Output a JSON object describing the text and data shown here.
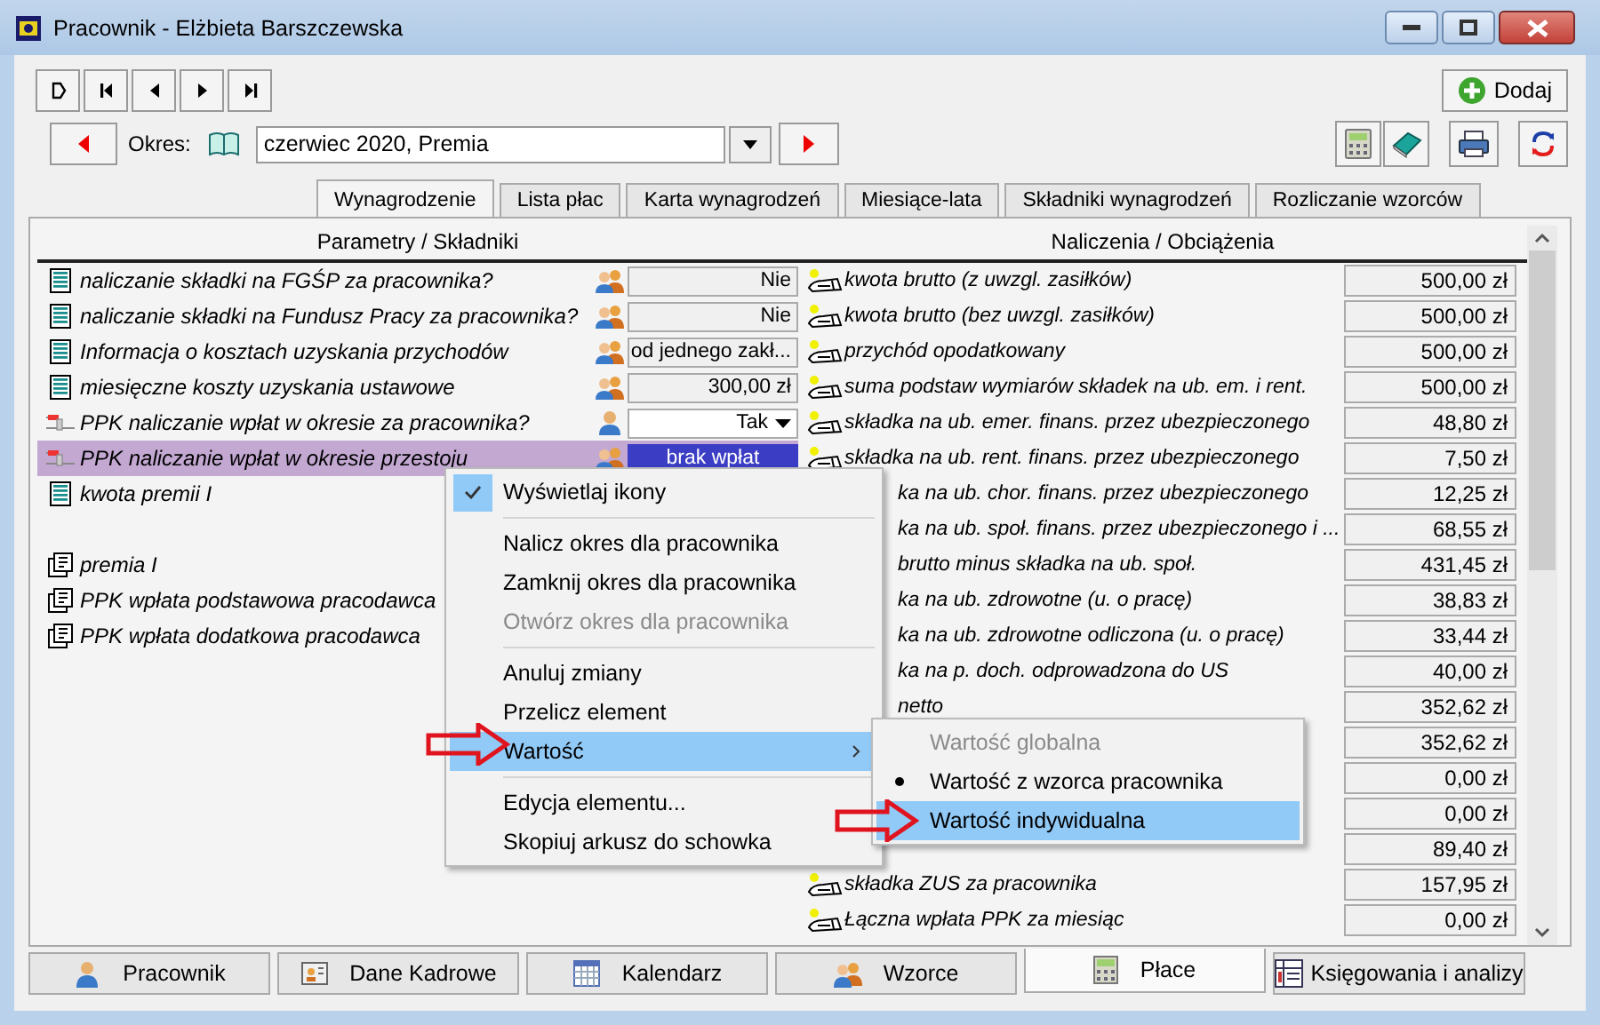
{
  "window": {
    "title": "Pracownik - Elżbieta Barszczewska"
  },
  "nav_buttons": [
    {
      "kind": "new"
    },
    {
      "kind": "first"
    },
    {
      "kind": "prev"
    },
    {
      "kind": "next"
    },
    {
      "kind": "last"
    }
  ],
  "add_button": {
    "label": "Dodaj"
  },
  "period": {
    "label": "Okres:",
    "value": "czerwiec 2020, Premia"
  },
  "tabs": [
    {
      "label": "Wynagrodzenie",
      "selected": true
    },
    {
      "label": "Lista płac",
      "selected": false
    },
    {
      "label": "Karta wynagrodzeń",
      "selected": false
    },
    {
      "label": "Miesiące-lata",
      "selected": false
    },
    {
      "label": "Składniki wynagrodzeń",
      "selected": false
    },
    {
      "label": "Rozliczanie wzorców",
      "selected": false
    }
  ],
  "left_panel": {
    "header": "Parametry / Składniki",
    "rows": [
      {
        "kind": "sheet",
        "name": "naliczanie składki na FGŚP za pracownika?",
        "individual": false,
        "value": "Nie",
        "has_dropdown": false,
        "selected": false
      },
      {
        "kind": "sheet",
        "name": "naliczanie składki na Fundusz Pracy za pracownika?",
        "individual": false,
        "value": "Nie",
        "has_dropdown": false,
        "selected": false
      },
      {
        "kind": "sheet",
        "name": "Informacja o kosztach uzyskania przychodów",
        "individual": false,
        "value": "od jednego zakł...",
        "has_dropdown": false,
        "selected": false
      },
      {
        "kind": "sheet",
        "name": "miesięczne koszty uzyskania ustawowe",
        "individual": false,
        "value": "300,00 zł",
        "has_dropdown": false,
        "selected": false
      },
      {
        "kind": "ppk",
        "name": "PPK naliczanie wpłat w okresie za pracownika?",
        "individual": true,
        "value": "Tak",
        "has_dropdown": true,
        "selected": false
      },
      {
        "kind": "ppk",
        "name": "PPK naliczanie wpłat w okresie przestoju",
        "individual": false,
        "value": "brak wpłat",
        "has_dropdown": false,
        "selected": true
      },
      {
        "kind": "sheet",
        "name": "kwota premii I",
        "selected": false
      },
      {
        "kind": "blank",
        "selected": false
      },
      {
        "kind": "formula",
        "name": "premia I",
        "selected": false
      },
      {
        "kind": "formula",
        "name": "PPK wpłata podstawowa pracodawca",
        "selected": false
      },
      {
        "kind": "formula",
        "name": "PPK wpłata dodatkowa pracodawca",
        "selected": false
      }
    ]
  },
  "right_panel": {
    "header": "Naliczenia / Obciążenia",
    "rows": [
      {
        "kind": "full",
        "name": "kwota brutto (z uwzgl. zasiłków)",
        "value": "500,00 zł"
      },
      {
        "kind": "full",
        "name": "kwota brutto (bez uwzgl. zasiłków)",
        "value": "500,00 zł"
      },
      {
        "kind": "full",
        "name": "przychód opodatkowany",
        "value": "500,00 zł"
      },
      {
        "kind": "full",
        "name": "suma podstaw wymiarów składek na ub. em. i rent.",
        "value": "500,00 zł"
      },
      {
        "kind": "full",
        "name": "składka na ub. emer. finans. przez ubezpieczonego",
        "value": "48,80 zł"
      },
      {
        "kind": "full",
        "name": "składka na ub. rent. finans. przez ubezpieczonego",
        "value": "7,50 zł"
      },
      {
        "kind": "covered",
        "name": "ka na ub. chor. finans. przez ubezpieczonego",
        "value": "12,25 zł"
      },
      {
        "kind": "covered",
        "name": "ka na ub. społ. finans. przez ubezpieczonego i ...",
        "value": "68,55 zł"
      },
      {
        "kind": "covered",
        "name": "brutto minus składka na ub. społ.",
        "value": "431,45 zł"
      },
      {
        "kind": "covered",
        "name": "ka na ub. zdrowotne (u. o pracę)",
        "value": "38,83 zł"
      },
      {
        "kind": "covered",
        "name": "ka na ub. zdrowotne odliczona (u. o pracę)",
        "value": "33,44 zł"
      },
      {
        "kind": "covered",
        "name": "ka na p. doch. odprowadzona do US",
        "value": "40,00 zł"
      },
      {
        "kind": "covered",
        "name": "netto",
        "value": "352,62 zł"
      },
      {
        "kind": "hidden",
        "value": "352,62 zł"
      },
      {
        "kind": "hidden",
        "value": "0,00 zł"
      },
      {
        "kind": "hidden",
        "value": "0,00 zł"
      },
      {
        "kind": "hidden",
        "value": "89,40 zł"
      },
      {
        "kind": "full",
        "name": "składka ZUS za pracownika",
        "value": "157,95 zł"
      },
      {
        "kind": "full",
        "name": "Łączna wpłata PPK za miesiąc",
        "value": "0,00 zł"
      }
    ]
  },
  "context_menu": {
    "items": [
      {
        "kind": "check",
        "label": "Wyświetlaj ikony",
        "checked": true
      },
      {
        "kind": "separator"
      },
      {
        "kind": "item",
        "label": "Nalicz okres dla pracownika",
        "disabled": false
      },
      {
        "kind": "item",
        "label": "Zamknij okres dla pracownika",
        "disabled": false
      },
      {
        "kind": "item",
        "label": "Otwórz okres dla pracownika",
        "disabled": true
      },
      {
        "kind": "separator"
      },
      {
        "kind": "item",
        "label": "Anuluj zmiany",
        "disabled": false
      },
      {
        "kind": "item",
        "label": "Przelicz element",
        "disabled": false
      },
      {
        "kind": "submenu",
        "label": "Wartość",
        "highlighted": true,
        "arrow_marked": true
      },
      {
        "kind": "separator"
      },
      {
        "kind": "item",
        "label": "Edycja elementu...",
        "disabled": false
      },
      {
        "kind": "item",
        "label": "Skopiuj arkusz do schowka",
        "disabled": false
      }
    ]
  },
  "submenu": {
    "items": [
      {
        "label": "Wartość globalna",
        "disabled": true,
        "bullet": false,
        "highlighted": false,
        "arrow_marked": false
      },
      {
        "label": "Wartość z wzorca pracownika",
        "disabled": false,
        "bullet": true,
        "highlighted": false,
        "arrow_marked": false
      },
      {
        "label": "Wartość indywidualna",
        "disabled": false,
        "bullet": false,
        "highlighted": true,
        "arrow_marked": true
      }
    ]
  },
  "bottom_tabs": [
    {
      "label": "Pracownik",
      "selected": false
    },
    {
      "label": "Dane Kadrowe",
      "selected": false
    },
    {
      "label": "Kalendarz",
      "selected": false
    },
    {
      "label": "Wzorce",
      "selected": false
    },
    {
      "label": "Płace",
      "selected": true
    },
    {
      "label": "Księgowania i analizy",
      "selected": false
    }
  ]
}
